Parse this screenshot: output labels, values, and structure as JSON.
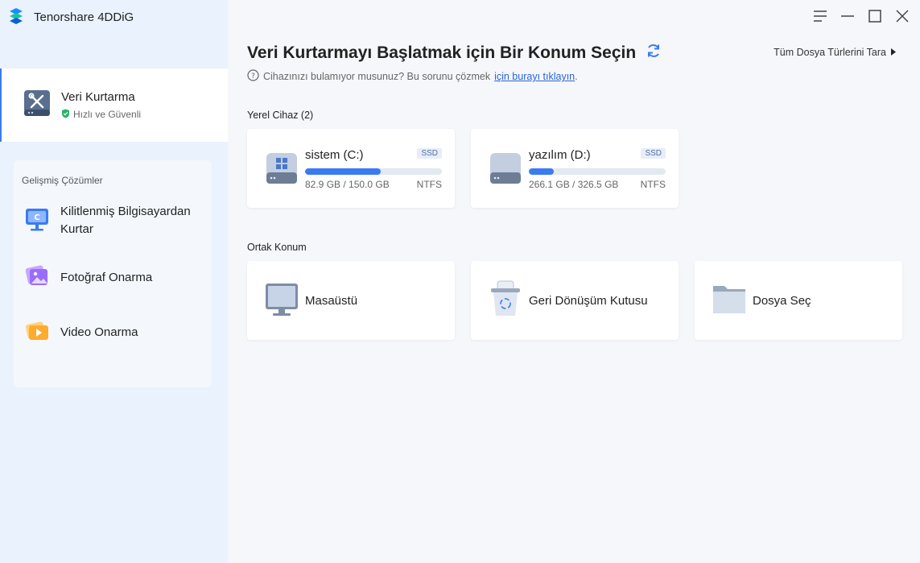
{
  "app": {
    "title": "Tenorshare 4DDiG"
  },
  "sidebar": {
    "active": {
      "title": "Veri Kurtarma",
      "subtitle": "Hızlı ve Güvenli"
    },
    "advanced": {
      "title": "Gelişmiş Çözümler",
      "items": [
        {
          "label": "Kilitlenmiş Bilgisayardan Kurtar",
          "icon": "locked-computer-icon"
        },
        {
          "label": "Fotoğraf Onarma",
          "icon": "photo-repair-icon"
        },
        {
          "label": "Video Onarma",
          "icon": "video-repair-icon"
        }
      ]
    }
  },
  "main": {
    "heading": "Veri Kurtarmayı Başlatmak için Bir Konum Seçin",
    "help_text": "Cihazınızı bulamıyor musunuz? Bu sorunu çözmek",
    "help_link": "için burayı tıklayın",
    "help_suffix": ".",
    "scan_all": "Tüm Dosya Türlerini Tara",
    "local_label": "Yerel Cihaz (2)",
    "drives": [
      {
        "name": "sistem (C:)",
        "type": "SSD",
        "used": "82.9 GB",
        "total": "150.0 GB",
        "size_text": "82.9 GB / 150.0 GB",
        "fs": "NTFS",
        "usage": 0.55
      },
      {
        "name": "yazılım (D:)",
        "type": "SSD",
        "used": "266.1 GB",
        "total": "326.5 GB",
        "size_text": "266.1 GB / 326.5 GB",
        "fs": "NTFS",
        "usage": 0.18
      }
    ],
    "common_label": "Ortak Konum",
    "locations": [
      {
        "label": "Masaüstü",
        "icon": "desktop-icon"
      },
      {
        "label": "Geri Dönüşüm Kutusu",
        "icon": "recycle-bin-icon"
      },
      {
        "label": "Dosya Seç",
        "icon": "folder-icon"
      }
    ]
  },
  "colors": {
    "accent": "#3a7bf4",
    "sidebar_bg": "#e9f2fd",
    "main_bg": "#f5f7fb"
  }
}
